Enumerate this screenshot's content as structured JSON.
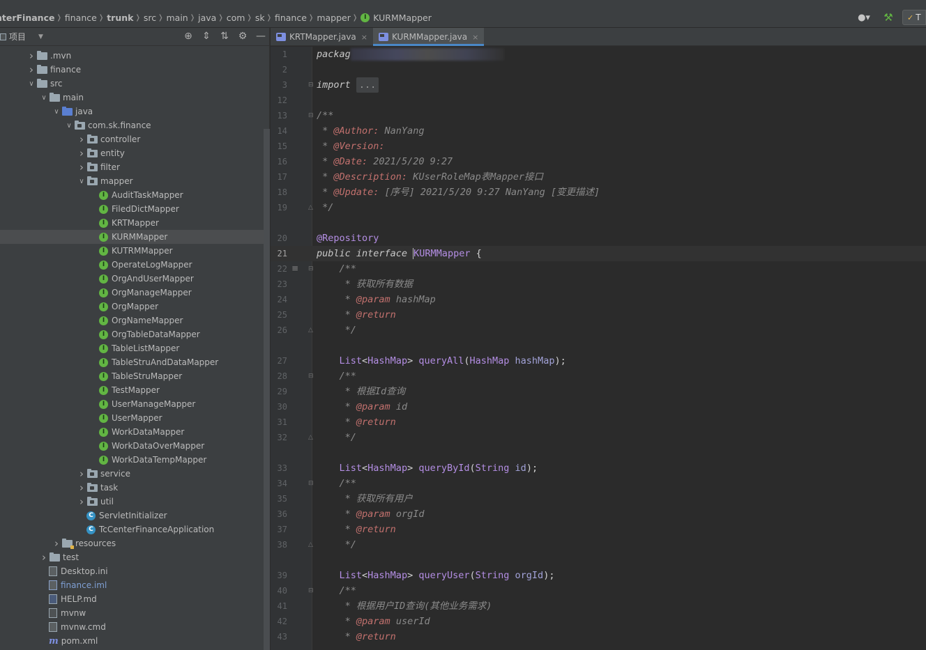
{
  "breadcrumbs": [
    {
      "label": "nterFinance",
      "bold": true
    },
    {
      "label": "finance",
      "bold": false
    },
    {
      "label": "trunk",
      "bold": true
    },
    {
      "label": "src",
      "bold": false
    },
    {
      "label": "main",
      "bold": false
    },
    {
      "label": "java",
      "bold": false
    },
    {
      "label": "com",
      "bold": false
    },
    {
      "label": "sk",
      "bold": false
    },
    {
      "label": "finance",
      "bold": false
    },
    {
      "label": "mapper",
      "bold": false
    }
  ],
  "breadcrumb_current": "KURMMapper",
  "icons": {
    "interface_letter": "I",
    "class_letter": "C",
    "run_config_short": "T",
    "ellipsis": "..."
  },
  "project_panel": {
    "title": "项目",
    "tree": [
      {
        "label": ".mvn",
        "indent": 0,
        "arrow": "right",
        "icon": "folder"
      },
      {
        "label": "finance",
        "indent": 0,
        "arrow": "right",
        "icon": "folder"
      },
      {
        "label": "src",
        "indent": 0,
        "arrow": "down",
        "icon": "folder"
      },
      {
        "label": "main",
        "indent": 1,
        "arrow": "down",
        "icon": "folder"
      },
      {
        "label": "java",
        "indent": 2,
        "arrow": "down",
        "icon": "folder-blue"
      },
      {
        "label": "com.sk.finance",
        "indent": 3,
        "arrow": "down",
        "icon": "package"
      },
      {
        "label": "controller",
        "indent": 4,
        "arrow": "right",
        "icon": "package"
      },
      {
        "label": "entity",
        "indent": 4,
        "arrow": "right",
        "icon": "package"
      },
      {
        "label": "filter",
        "indent": 4,
        "arrow": "right",
        "icon": "package"
      },
      {
        "label": "mapper",
        "indent": 4,
        "arrow": "down",
        "icon": "package"
      },
      {
        "label": "AuditTaskMapper",
        "indent": 5,
        "arrow": "",
        "icon": "interface"
      },
      {
        "label": "FiledDictMapper",
        "indent": 5,
        "arrow": "",
        "icon": "interface"
      },
      {
        "label": "KRTMapper",
        "indent": 5,
        "arrow": "",
        "icon": "interface"
      },
      {
        "label": "KURMMapper",
        "indent": 5,
        "arrow": "",
        "icon": "interface",
        "selected": true
      },
      {
        "label": "KUTRMMapper",
        "indent": 5,
        "arrow": "",
        "icon": "interface"
      },
      {
        "label": "OperateLogMapper",
        "indent": 5,
        "arrow": "",
        "icon": "interface"
      },
      {
        "label": "OrgAndUserMapper",
        "indent": 5,
        "arrow": "",
        "icon": "interface"
      },
      {
        "label": "OrgManageMapper",
        "indent": 5,
        "arrow": "",
        "icon": "interface"
      },
      {
        "label": "OrgMapper",
        "indent": 5,
        "arrow": "",
        "icon": "interface"
      },
      {
        "label": "OrgNameMapper",
        "indent": 5,
        "arrow": "",
        "icon": "interface"
      },
      {
        "label": "OrgTableDataMapper",
        "indent": 5,
        "arrow": "",
        "icon": "interface"
      },
      {
        "label": "TableListMapper",
        "indent": 5,
        "arrow": "",
        "icon": "interface"
      },
      {
        "label": "TableStruAndDataMapper",
        "indent": 5,
        "arrow": "",
        "icon": "interface"
      },
      {
        "label": "TableStruMapper",
        "indent": 5,
        "arrow": "",
        "icon": "interface"
      },
      {
        "label": "TestMapper",
        "indent": 5,
        "arrow": "",
        "icon": "interface"
      },
      {
        "label": "UserManageMapper",
        "indent": 5,
        "arrow": "",
        "icon": "interface"
      },
      {
        "label": "UserMapper",
        "indent": 5,
        "arrow": "",
        "icon": "interface"
      },
      {
        "label": "WorkDataMapper",
        "indent": 5,
        "arrow": "",
        "icon": "interface"
      },
      {
        "label": "WorkDataOverMapper",
        "indent": 5,
        "arrow": "",
        "icon": "interface"
      },
      {
        "label": "WorkDataTempMapper",
        "indent": 5,
        "arrow": "",
        "icon": "interface"
      },
      {
        "label": "service",
        "indent": 4,
        "arrow": "right",
        "icon": "package"
      },
      {
        "label": "task",
        "indent": 4,
        "arrow": "right",
        "icon": "package"
      },
      {
        "label": "util",
        "indent": 4,
        "arrow": "right",
        "icon": "package"
      },
      {
        "label": "ServletInitializer",
        "indent": 4,
        "arrow": "",
        "icon": "class"
      },
      {
        "label": "TcCenterFinanceApplication",
        "indent": 4,
        "arrow": "",
        "icon": "class"
      },
      {
        "label": "resources",
        "indent": 2,
        "arrow": "right",
        "icon": "resources"
      },
      {
        "label": "test",
        "indent": 1,
        "arrow": "right",
        "icon": "folder"
      },
      {
        "label": "Desktop.ini",
        "indent": 1,
        "arrow": "",
        "icon": "file"
      },
      {
        "label": "finance.iml",
        "indent": 1,
        "arrow": "",
        "icon": "iml"
      },
      {
        "label": "HELP.md",
        "indent": 1,
        "arrow": "",
        "icon": "md"
      },
      {
        "label": "mvnw",
        "indent": 1,
        "arrow": "",
        "icon": "sh"
      },
      {
        "label": "mvnw.cmd",
        "indent": 1,
        "arrow": "",
        "icon": "file"
      },
      {
        "label": "pom.xml",
        "indent": 1,
        "arrow": "",
        "icon": "maven"
      }
    ]
  },
  "tabs": [
    {
      "label": "KRTMapper.java",
      "active": false
    },
    {
      "label": "KURMMapper.java",
      "active": true
    }
  ],
  "editor": {
    "current_line": "21",
    "lines": [
      {
        "n": "1",
        "html": "<span class=\"kw\">packag</span><span class=\"blur\"></span>"
      },
      {
        "n": "2",
        "html": ""
      },
      {
        "n": "3",
        "html": "<span class=\"kw\">import</span> <span class=\"ph\">...</span>",
        "mark": "fold"
      },
      {
        "n": "12",
        "html": ""
      },
      {
        "n": "13",
        "html": "<span class=\"gray\">/**</span>",
        "mark": "fold"
      },
      {
        "n": "14",
        "html": "<span class=\"gray\"> * </span><span class=\"tag\">@Author:</span><span class=\"tagv\"> NanYang</span>"
      },
      {
        "n": "15",
        "html": "<span class=\"gray\"> * </span><span class=\"tag\">@Version:</span>"
      },
      {
        "n": "16",
        "html": "<span class=\"gray\"> * </span><span class=\"tag\">@Date:</span><span class=\"tagv\"> 2021/5/20 9:27</span>"
      },
      {
        "n": "17",
        "html": "<span class=\"gray\"> * </span><span class=\"tag\">@Description:</span><span class=\"tagv\"> KUserRoleMap表Mapper接口</span>"
      },
      {
        "n": "18",
        "html": "<span class=\"gray\"> * </span><span class=\"tag\">@Update:</span><span class=\"tagv\"> [序号] 2021/5/20 9:27 NanYang [变更描述]</span>"
      },
      {
        "n": "19",
        "html": "<span class=\"gray\"> */</span>",
        "mark": "fold-end"
      },
      {
        "n": "20",
        "html": "<span class=\"ann2\">@Repository</span>"
      },
      {
        "n": "21",
        "html": "<span class=\"kw\">public interface </span><span class=\"caret\"></span><span class=\"type\">KURMMapper</span><span class=\"plain\"> {</span>"
      },
      {
        "n": "22",
        "html": "    <span class=\"gray\">/**</span>",
        "mark": "fold",
        "doc": true
      },
      {
        "n": "23",
        "html": "<span class=\"gray\">     * 获取所有数据</span>"
      },
      {
        "n": "24",
        "html": "<span class=\"gray\">     * </span><span class=\"tag\">@param</span><span class=\"tagv\"> hashMap</span>"
      },
      {
        "n": "25",
        "html": "<span class=\"gray\">     * </span><span class=\"tag\">@return</span>"
      },
      {
        "n": "26",
        "html": "<span class=\"gray\">     */</span>",
        "mark": "fold-end"
      },
      {
        "n": "27",
        "html": "    <span class=\"meth\">List</span><span class=\"plain\">&lt;</span><span class=\"meth\">HashMap</span><span class=\"plain\">&gt; </span><span class=\"meth\">queryAll</span><span class=\"plain\">(</span><span class=\"meth\">HashMap</span><span class=\"param\"> hashMap</span><span class=\"plain\">);</span>"
      },
      {
        "n": "28",
        "html": "    <span class=\"gray\">/**</span>",
        "mark": "fold"
      },
      {
        "n": "29",
        "html": "<span class=\"gray\">     * 根据Id查询</span>"
      },
      {
        "n": "30",
        "html": "<span class=\"gray\">     * </span><span class=\"tag\">@param</span><span class=\"tagv\"> id</span>"
      },
      {
        "n": "31",
        "html": "<span class=\"gray\">     * </span><span class=\"tag\">@return</span>"
      },
      {
        "n": "32",
        "html": "<span class=\"gray\">     */</span>",
        "mark": "fold-end"
      },
      {
        "n": "33",
        "html": "    <span class=\"meth\">List</span><span class=\"plain\">&lt;</span><span class=\"meth\">HashMap</span><span class=\"plain\">&gt; </span><span class=\"meth\">queryById</span><span class=\"plain\">(</span><span class=\"meth\">String</span><span class=\"param\"> id</span><span class=\"plain\">);</span>"
      },
      {
        "n": "34",
        "html": "    <span class=\"gray\">/**</span>",
        "mark": "fold"
      },
      {
        "n": "35",
        "html": "<span class=\"gray\">     * 获取所有用户</span>"
      },
      {
        "n": "36",
        "html": "<span class=\"gray\">     * </span><span class=\"tag\">@param</span><span class=\"tagv\"> orgId</span>"
      },
      {
        "n": "37",
        "html": "<span class=\"gray\">     * </span><span class=\"tag\">@return</span>"
      },
      {
        "n": "38",
        "html": "<span class=\"gray\">     */</span>",
        "mark": "fold-end"
      },
      {
        "n": "39",
        "html": "    <span class=\"meth\">List</span><span class=\"plain\">&lt;</span><span class=\"meth\">HashMap</span><span class=\"plain\">&gt; </span><span class=\"meth\">queryUser</span><span class=\"plain\">(</span><span class=\"meth\">String</span><span class=\"param\"> orgId</span><span class=\"plain\">);</span>"
      },
      {
        "n": "40",
        "html": "    <span class=\"gray\">/**</span>",
        "mark": "fold"
      },
      {
        "n": "41",
        "html": "<span class=\"gray\">     * 根据用户ID查询(其他业务需求)</span>"
      },
      {
        "n": "42",
        "html": "<span class=\"gray\">     * </span><span class=\"tag\">@param</span><span class=\"tagv\"> userId</span>"
      },
      {
        "n": "43",
        "html": "<span class=\"gray\">     * </span><span class=\"tag\">@return</span>"
      }
    ]
  }
}
